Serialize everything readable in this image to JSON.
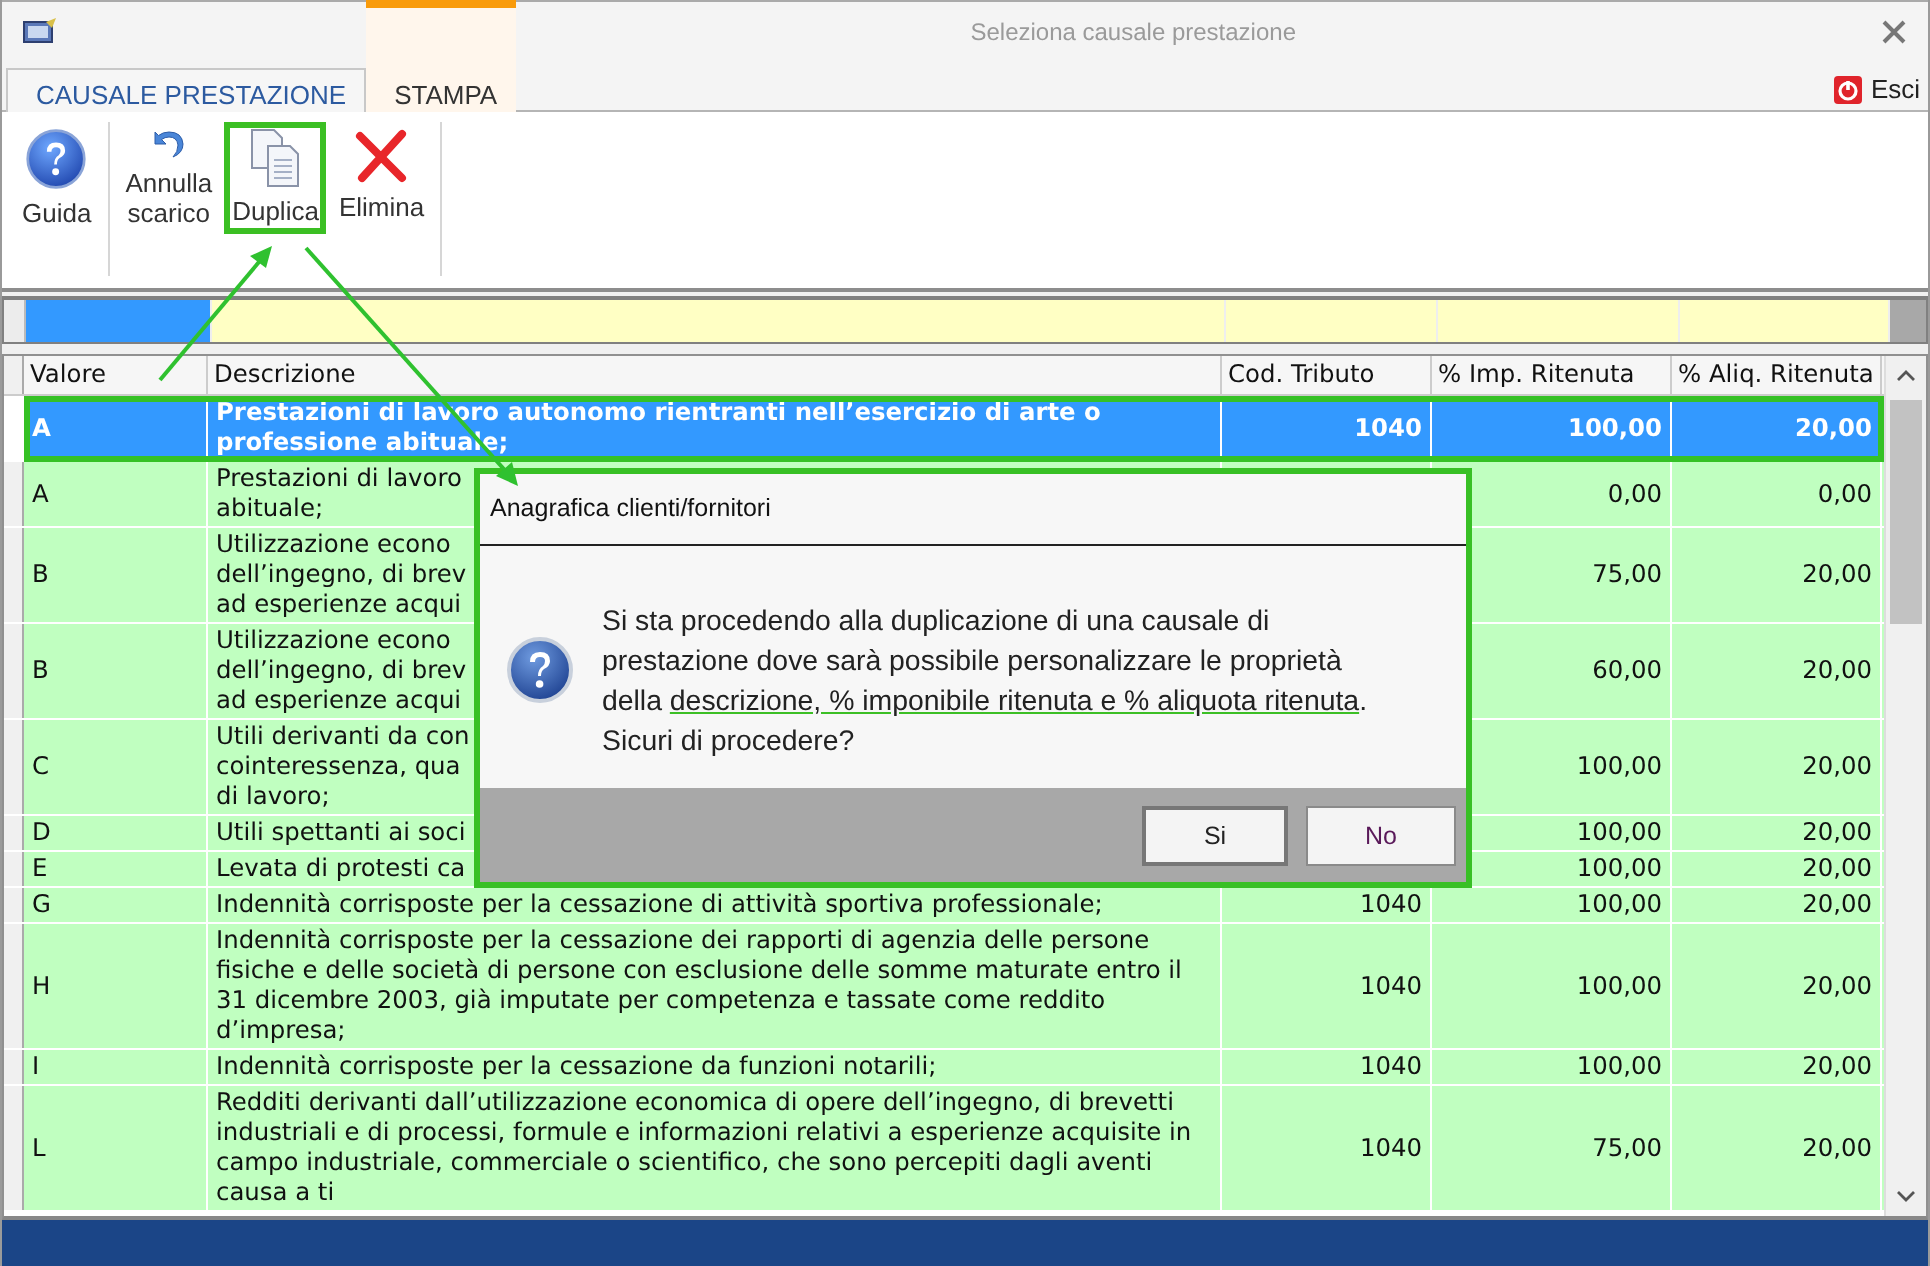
{
  "window": {
    "title": "Seleziona causale prestazione"
  },
  "tabs": [
    {
      "label": "CAUSALE PRESTAZIONE",
      "selected": true
    },
    {
      "label": "STAMPA",
      "selected": false
    }
  ],
  "exit_button": {
    "label": "Esci"
  },
  "toolbar_groups": [
    [
      {
        "kind": "help",
        "label": "Guida",
        "highlighted": false
      }
    ],
    [
      {
        "kind": "undo",
        "label": "Annulla\nscarico",
        "highlighted": false
      },
      {
        "kind": "duplicate",
        "label": "Duplica",
        "highlighted": true
      },
      {
        "kind": "delete",
        "label": "Elimina",
        "highlighted": false
      }
    ]
  ],
  "filter_row": [
    {
      "selected": true
    },
    {
      "selected": false
    },
    {
      "selected": false
    },
    {
      "selected": false
    },
    {
      "selected": false
    }
  ],
  "table": {
    "columns": [
      "Valore",
      "Descrizione",
      "Cod. Tributo",
      "% Imp. Ritenuta",
      "% Aliq. Ritenuta"
    ],
    "rows": [
      {
        "valore": "A",
        "descrizione": "Prestazioni di lavoro autonomo rientranti nell’esercizio di arte o\nprofessione abituale;",
        "cod": "1040",
        "imp": "100,00",
        "aliq": "20,00",
        "selected": true
      },
      {
        "valore": "A",
        "descrizione": "Prestazioni di lavoro\nabituale;",
        "imp": "0,00",
        "aliq": "0,00",
        "selected": false
      },
      {
        "valore": "B",
        "descrizione": "Utilizzazione econo\ndell’ingegno, di brev\nad esperienze acqui",
        "imp": "75,00",
        "aliq": "20,00",
        "selected": false
      },
      {
        "valore": "B",
        "descrizione": "Utilizzazione econo\ndell’ingegno, di brev\nad esperienze acqui",
        "imp": "60,00",
        "aliq": "20,00",
        "selected": false
      },
      {
        "valore": "C",
        "descrizione": "Utili derivanti da con\ncointeressenza, qua\ndi lavoro;",
        "imp": "100,00",
        "aliq": "20,00",
        "selected": false
      },
      {
        "valore": "D",
        "descrizione": "Utili spettanti ai soci",
        "imp": "100,00",
        "aliq": "20,00",
        "selected": false
      },
      {
        "valore": "E",
        "descrizione": "Levata di protesti ca",
        "imp": "100,00",
        "aliq": "20,00",
        "selected": false
      },
      {
        "valore": "G",
        "descrizione": "Indennità corrisposte per la cessazione di attività sportiva professionale;",
        "cod": "1040",
        "imp": "100,00",
        "aliq": "20,00",
        "selected": false
      },
      {
        "valore": "H",
        "descrizione": "Indennità corrisposte per la cessazione dei rapporti di agenzia delle persone\nfisiche e delle società di persone con esclusione delle somme maturate entro il\n31 dicembre 2003, già imputate per competenza e tassate come reddito\nd’impresa;",
        "cod": "1040",
        "imp": "100,00",
        "aliq": "20,00",
        "selected": false
      },
      {
        "valore": "I",
        "descrizione": "Indennità corrisposte per la cessazione da funzioni notarili;",
        "cod": "1040",
        "imp": "100,00",
        "aliq": "20,00",
        "selected": false
      },
      {
        "valore": "L",
        "descrizione": "Redditi derivanti dall’utilizzazione economica di opere dell’ingegno, di brevetti\nindustriali e di processi, formule e informazioni relativi a esperienze acquisite in\ncampo industriale, commerciale o scientifico, che sono percepiti dagli aventi\ncausa a ti",
        "cod": "1040",
        "imp": "75,00",
        "aliq": "20,00",
        "selected": false
      }
    ]
  },
  "dialog": {
    "title": "Anagrafica clienti/fornitori",
    "message": {
      "before": "Si sta procedendo alla duplicazione di una causale di\nprestazione dove sarà possibile personalizzare le proprietà\ndella ",
      "highlighted": "descrizione, % imponibile ritenuta e % aliquota ritenuta",
      "after": ".\nSicuri di procedere?"
    },
    "buttons": [
      "Si",
      "No"
    ]
  }
}
